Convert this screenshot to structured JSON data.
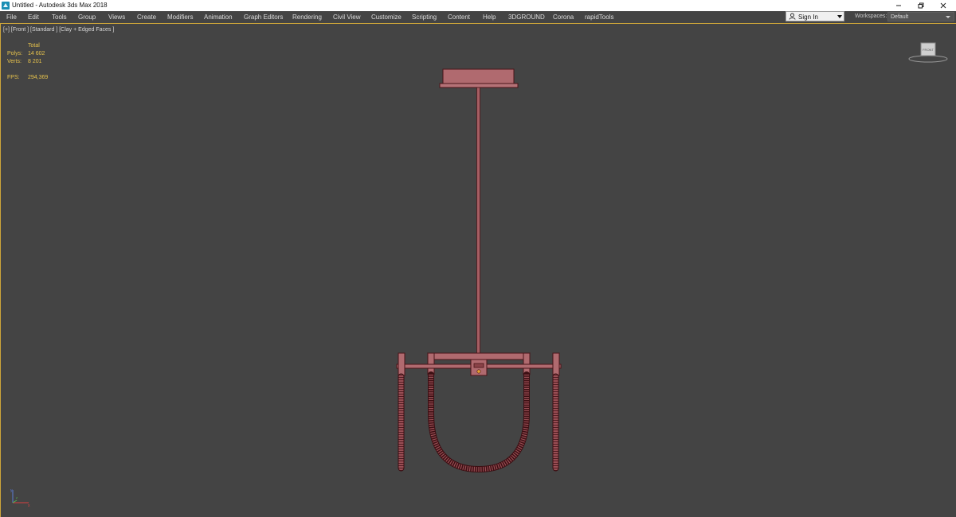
{
  "window": {
    "title": "Untitled - Autodesk 3ds Max 2018",
    "buttons": [
      "minimize-icon",
      "restore-icon",
      "close-icon"
    ]
  },
  "menu": {
    "items": [
      {
        "label": "File"
      },
      {
        "label": "Edit"
      },
      {
        "label": "Tools"
      },
      {
        "label": "Group"
      },
      {
        "label": "Views"
      },
      {
        "label": "Create"
      },
      {
        "label": "Modifiers"
      },
      {
        "label": "Animation"
      },
      {
        "label": "Graph Editors"
      },
      {
        "label": "Rendering"
      },
      {
        "label": "Civil View"
      },
      {
        "label": "Customize"
      },
      {
        "label": "Scripting"
      },
      {
        "label": "Content"
      },
      {
        "label": "Help"
      },
      {
        "label": "3DGROUND"
      },
      {
        "label": "Corona"
      },
      {
        "label": "rapidTools"
      }
    ],
    "sign_in": "Sign In",
    "workspaces_label": "Workspaces:",
    "workspaces_value": "Default"
  },
  "viewport": {
    "label": "[+] [Front ] [Standard ] [Clay + Edged Faces ]",
    "stats": {
      "total": "Total",
      "polys_label": "Polys:",
      "polys_value": "14 602",
      "verts_label": "Verts:",
      "verts_value": "8 201",
      "fps_label": "FPS:",
      "fps_value": "294,369"
    },
    "viewcube_label": "FRONT",
    "axis": [
      "y",
      "x",
      "z"
    ]
  },
  "colors": {
    "viewport_bg": "#444444",
    "model_fill": "#b06a6f",
    "model_edge": "#4a1418",
    "stats_text": "#e6c24c",
    "active_border": "#cda53a"
  }
}
